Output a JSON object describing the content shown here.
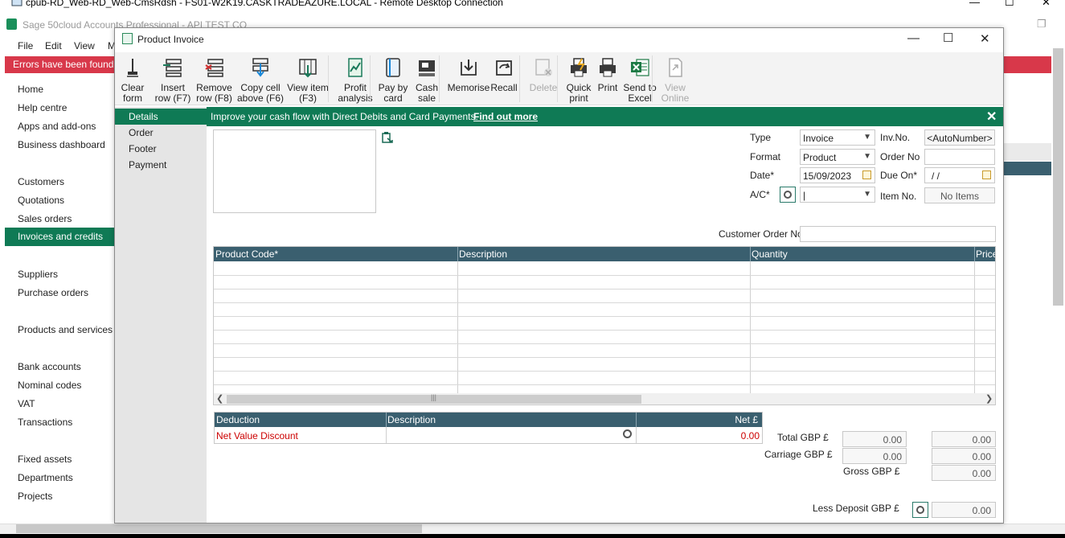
{
  "rdp": {
    "title": "cpub-RD_Web-RD_Web-CmsRdsh - FS01-W2K19.CASKTRADEAZURE.LOCAL - Remote Desktop Connection",
    "min": "—",
    "max": "☐",
    "close": "✕"
  },
  "sage": {
    "title": "Sage 50cloud Accounts Professional - API TEST CO",
    "menu": [
      "File",
      "Edit",
      "View",
      "M"
    ],
    "error": "Errors have been found in y"
  },
  "sidebar": {
    "group1": [
      "Home",
      "Help centre",
      "Apps and add-ons",
      "Business dashboard"
    ],
    "group2": [
      "Customers",
      "Quotations",
      "Sales orders",
      "Invoices and credits"
    ],
    "group3": [
      "Suppliers",
      "Purchase orders"
    ],
    "group4": [
      "Products and services"
    ],
    "group5": [
      "Bank accounts",
      "Nominal codes",
      "VAT",
      "Transactions"
    ],
    "group6": [
      "Fixed assets",
      "Departments",
      "Projects"
    ]
  },
  "dialog": {
    "title": "Product Invoice",
    "toolbar": [
      {
        "label": "Clear\nform",
        "icon": "clear-form-icon",
        "enabled": true
      },
      {
        "label": "Insert\nrow (F7)",
        "icon": "insert-row-icon",
        "enabled": true
      },
      {
        "label": "Remove\nrow (F8)",
        "icon": "remove-row-icon",
        "enabled": true
      },
      {
        "label": "Copy cell\nabove (F6)",
        "icon": "copy-cell-icon",
        "enabled": true
      },
      {
        "label": "View item\n(F3)",
        "icon": "view-item-icon",
        "enabled": true
      },
      {
        "label": "Profit\nanalysis",
        "icon": "profit-analysis-icon",
        "enabled": true
      },
      {
        "label": "Pay by\ncard",
        "icon": "pay-by-card-icon",
        "enabled": true
      },
      {
        "label": "Cash\nsale",
        "icon": "cash-sale-icon",
        "enabled": true
      },
      {
        "label": "Memorise",
        "icon": "memorise-icon",
        "enabled": true
      },
      {
        "label": "Recall",
        "icon": "recall-icon",
        "enabled": true
      },
      {
        "label": "Delete",
        "icon": "delete-icon",
        "enabled": false
      },
      {
        "label": "Quick\nprint",
        "icon": "quick-print-icon",
        "enabled": true
      },
      {
        "label": "Print",
        "icon": "print-icon",
        "enabled": true
      },
      {
        "label": "Send to\nExcel",
        "icon": "excel-icon",
        "enabled": true
      },
      {
        "label": "View\nOnline",
        "icon": "view-online-icon",
        "enabled": false
      }
    ],
    "tabs": [
      "Details",
      "Order",
      "Footer",
      "Payment"
    ],
    "promo": {
      "text": "Improve your cash flow with Direct Debits and Card Payments.",
      "link": "Find out more"
    },
    "header": {
      "type_label": "Type",
      "type_value": "Invoice",
      "format_label": "Format",
      "format_value": "Product",
      "date_label": "Date*",
      "date_value": "15/09/2023",
      "ac_label": "A/C*",
      "ac_value": "|",
      "invno_label": "Inv.No.",
      "invno_value": "<AutoNumber>",
      "orderno_label": "Order No",
      "orderno_value": "",
      "dueon_label": "Due On*",
      "dueon_value": "/ /",
      "itemno_label": "Item No.",
      "itemno_value": "No Items",
      "custorder_label": "Customer Order No.",
      "custorder_value": ""
    },
    "grid": {
      "columns": [
        "Product Code*",
        "Description",
        "Quantity",
        "Price"
      ]
    },
    "deduction": {
      "columns": [
        "Deduction",
        "Description",
        "Net £"
      ],
      "row": {
        "deduction": "Net Value Discount",
        "description": "",
        "net": "0.00"
      }
    },
    "totals": {
      "total_label": "Total GBP £",
      "total_net": "0.00",
      "total_vat": "0.00",
      "carriage_label": "Carriage GBP £",
      "carriage_net": "0.00",
      "carriage_vat": "0.00",
      "gross_label": "Gross GBP £",
      "gross_value": "0.00",
      "deposit_label": "Less Deposit GBP £",
      "deposit_value": "0.00"
    }
  },
  "colors": {
    "accent": "#0f7a55",
    "header": "#3a5f6f",
    "error": "#d8384a",
    "discount_text": "#cc0000"
  }
}
